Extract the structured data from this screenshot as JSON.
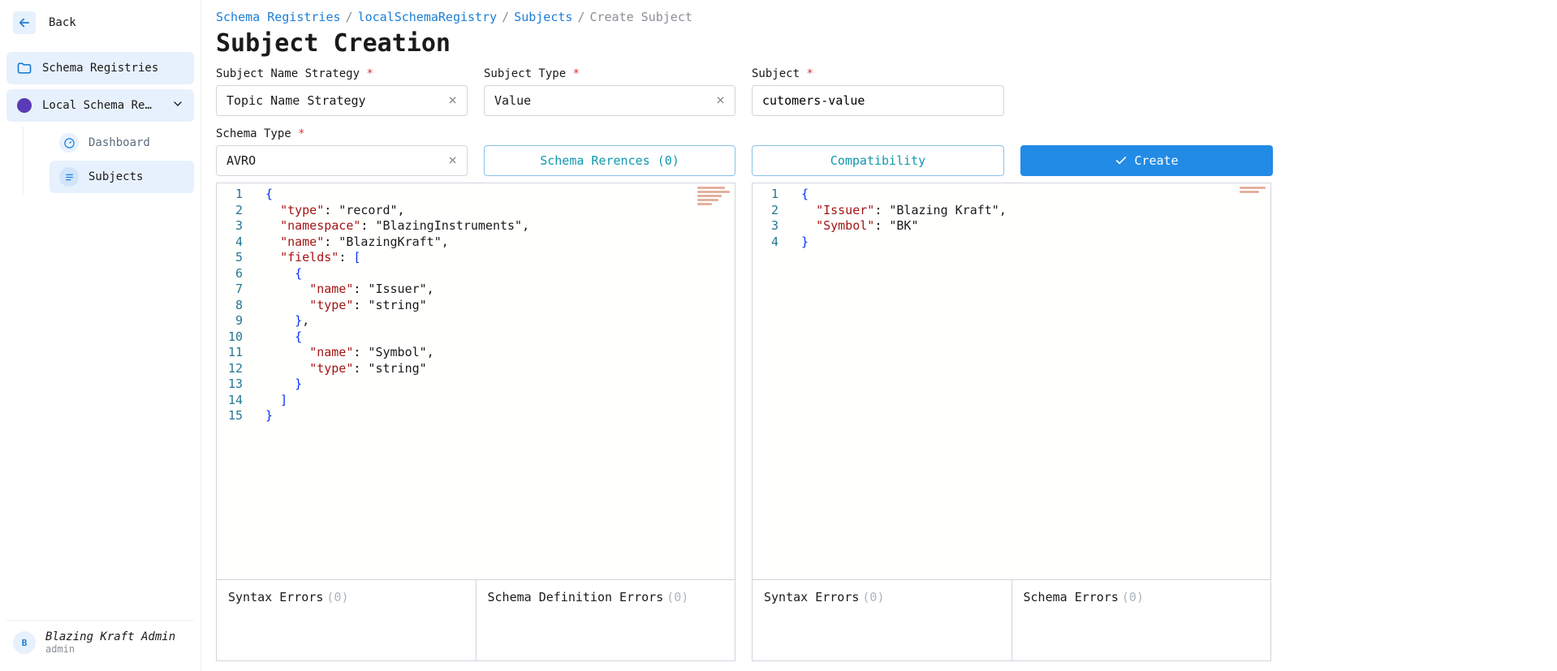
{
  "sidebar": {
    "back_label": "Back",
    "registries_label": "Schema Registries",
    "local_label": "Local Schema Regi…",
    "items": [
      {
        "label": "Dashboard"
      },
      {
        "label": "Subjects"
      }
    ],
    "footer_name": "Blazing Kraft Admin",
    "footer_role": "admin",
    "avatar_initial": "B"
  },
  "breadcrumb": {
    "a": "Schema Registries",
    "b": "localSchemaRegistry",
    "c": "Subjects",
    "current": "Create Subject"
  },
  "page_title": "Subject Creation",
  "form": {
    "name_strategy_label": "Subject Name Strategy",
    "name_strategy_value": "Topic Name Strategy",
    "subject_type_label": "Subject Type",
    "subject_type_value": "Value",
    "subject_label": "Subject",
    "subject_value": "cutomers-value",
    "schema_type_label": "Schema Type",
    "schema_type_value": "AVRO",
    "references_btn": "Schema Rerences (0)",
    "compatibility_btn": "Compatibility",
    "create_btn": "Create"
  },
  "editors": {
    "left_lines": [
      "{",
      "  \"type\": \"record\",",
      "  \"namespace\": \"BlazingInstruments\",",
      "  \"name\": \"BlazingKraft\",",
      "  \"fields\": [",
      "    {",
      "      \"name\": \"Issuer\",",
      "      \"type\": \"string\"",
      "    },",
      "    {",
      "      \"name\": \"Symbol\",",
      "      \"type\": \"string\"",
      "    }",
      "  ]",
      "}"
    ],
    "right_lines": [
      "{",
      "  \"Issuer\": \"Blazing Kraft\",",
      "  \"Symbol\": \"BK\"",
      "}"
    ]
  },
  "errors": {
    "left_syntax_label": "Syntax Errors",
    "left_def_label": "Schema Definition Errors",
    "right_syntax_label": "Syntax Errors",
    "right_schema_label": "Schema Errors",
    "count_zero": "(0)"
  }
}
